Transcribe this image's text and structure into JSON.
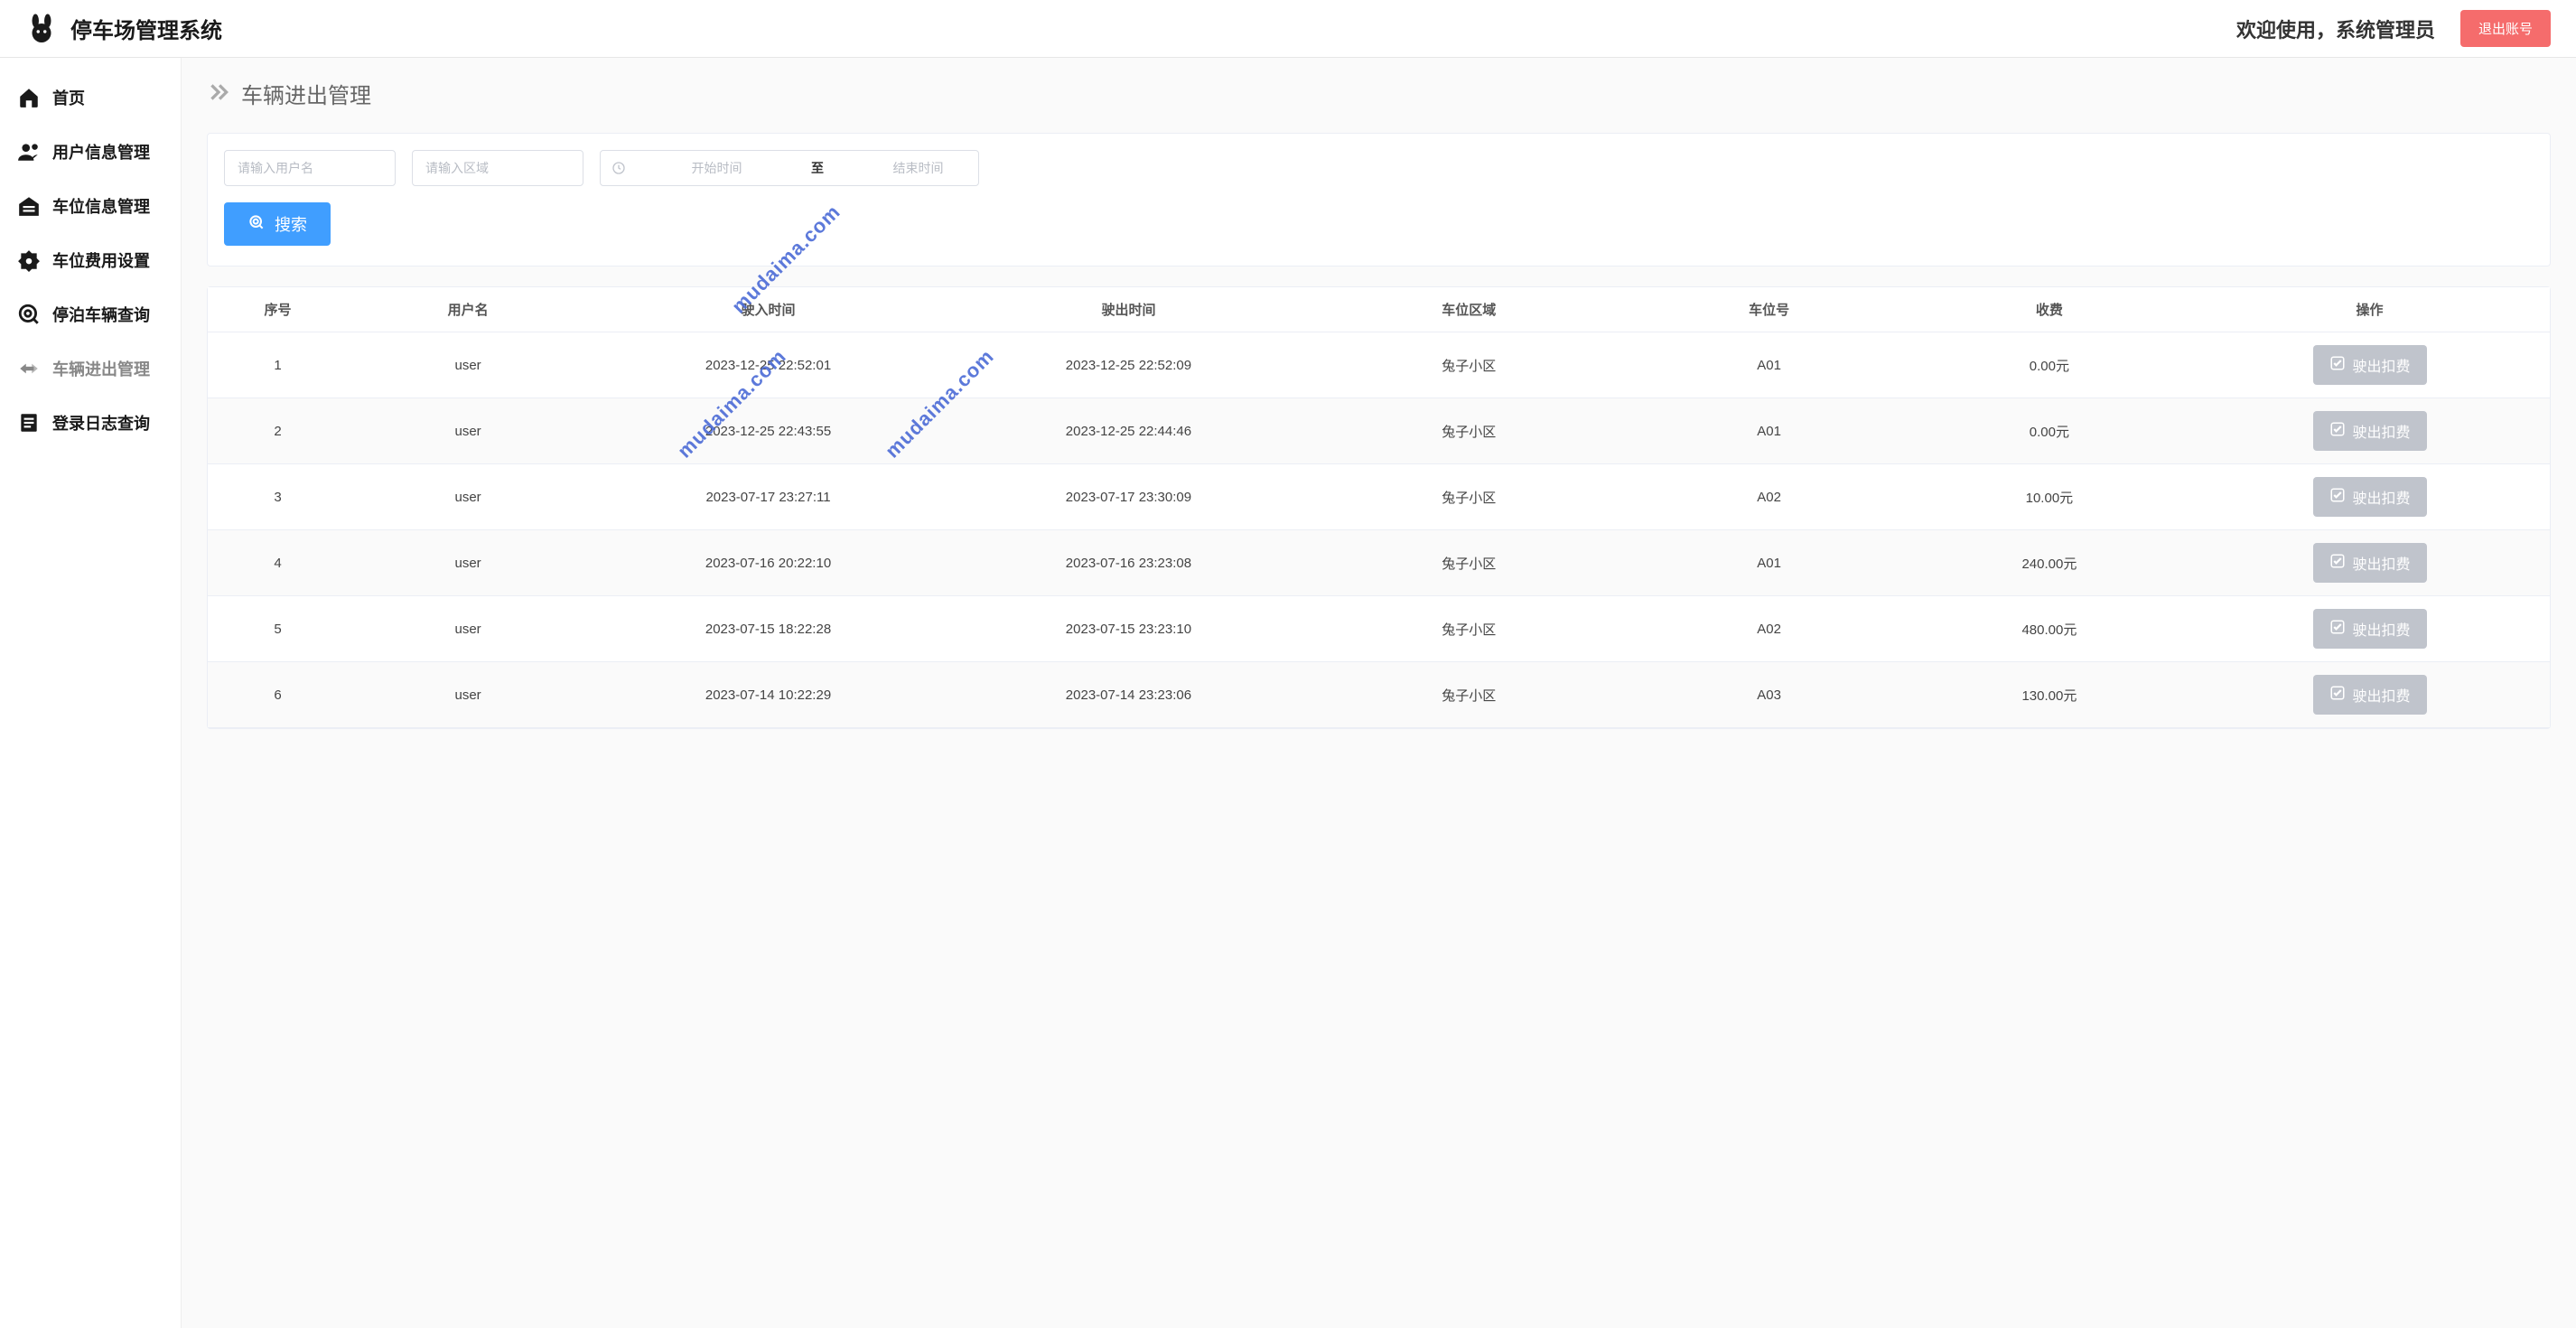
{
  "header": {
    "app_title": "停车场管理系统",
    "welcome": "欢迎使用，系统管理员",
    "logout_label": "退出账号"
  },
  "sidebar": {
    "items": [
      {
        "label": "首页",
        "icon": "home-icon"
      },
      {
        "label": "用户信息管理",
        "icon": "user-icon"
      },
      {
        "label": "车位信息管理",
        "icon": "garage-icon"
      },
      {
        "label": "车位费用设置",
        "icon": "fee-icon"
      },
      {
        "label": "停泊车辆查询",
        "icon": "search-car-icon"
      },
      {
        "label": "车辆进出管理",
        "icon": "inout-icon"
      },
      {
        "label": "登录日志查询",
        "icon": "log-icon"
      }
    ],
    "active_index": 5
  },
  "page": {
    "title": "车辆进出管理"
  },
  "search": {
    "username_placeholder": "请输入用户名",
    "area_placeholder": "请输入区域",
    "start_placeholder": "开始时间",
    "range_separator": "至",
    "end_placeholder": "结束时间",
    "button_label": "搜索"
  },
  "table": {
    "headers": [
      "序号",
      "用户名",
      "驶入时间",
      "驶出时间",
      "车位区域",
      "车位号",
      "收费",
      "操作"
    ],
    "op_button_label": "驶出扣费",
    "rows": [
      {
        "idx": "1",
        "user": "user",
        "in_time": "2023-12-25 22:52:01",
        "out_time": "2023-12-25 22:52:09",
        "area": "兔子小区",
        "slot": "A01",
        "fee": "0.00元"
      },
      {
        "idx": "2",
        "user": "user",
        "in_time": "2023-12-25 22:43:55",
        "out_time": "2023-12-25 22:44:46",
        "area": "兔子小区",
        "slot": "A01",
        "fee": "0.00元"
      },
      {
        "idx": "3",
        "user": "user",
        "in_time": "2023-07-17 23:27:11",
        "out_time": "2023-07-17 23:30:09",
        "area": "兔子小区",
        "slot": "A02",
        "fee": "10.00元"
      },
      {
        "idx": "4",
        "user": "user",
        "in_time": "2023-07-16 20:22:10",
        "out_time": "2023-07-16 23:23:08",
        "area": "兔子小区",
        "slot": "A01",
        "fee": "240.00元"
      },
      {
        "idx": "5",
        "user": "user",
        "in_time": "2023-07-15 18:22:28",
        "out_time": "2023-07-15 23:23:10",
        "area": "兔子小区",
        "slot": "A02",
        "fee": "480.00元"
      },
      {
        "idx": "6",
        "user": "user",
        "in_time": "2023-07-14 10:22:29",
        "out_time": "2023-07-14 23:23:06",
        "area": "兔子小区",
        "slot": "A03",
        "fee": "130.00元"
      }
    ]
  },
  "watermark_text": "mudaima.com"
}
